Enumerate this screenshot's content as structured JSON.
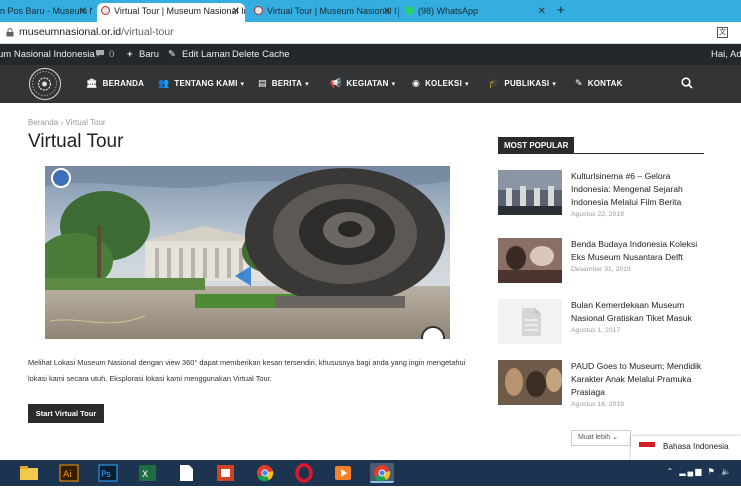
{
  "browser": {
    "tabs": [
      {
        "title": "n Pos Baru - Museum N",
        "active": false
      },
      {
        "title": "Virtual Tour | Museum Nasional In",
        "active": true
      },
      {
        "title": "Virtual Tour | Museum Nasional Ind",
        "active": false
      },
      {
        "title": "(98) WhatsApp",
        "active": false
      }
    ],
    "new_tab_symbol": "+",
    "close_symbol": "✕",
    "url_host": "museumnasional.or.id",
    "url_path": "/virtual-tour",
    "translate_label": "文"
  },
  "admin_bar": {
    "site_name": "um Nasional Indonesia",
    "comments_count": "0",
    "new_label": "Baru",
    "edit_label": "Edit Laman",
    "cache_label": "Delete Cache",
    "greeting": "Hai, Adr"
  },
  "nav": {
    "items": [
      {
        "label": "BERANDA",
        "icon": "bank-icon"
      },
      {
        "label": "TENTANG KAMI",
        "icon": "users-icon",
        "dropdown": true
      },
      {
        "label": "BERITA",
        "icon": "newspaper-icon",
        "dropdown": true
      },
      {
        "label": "KEGIATAN",
        "icon": "megaphone-icon",
        "dropdown": true
      },
      {
        "label": "KOLEKSI",
        "icon": "target-icon",
        "dropdown": true
      },
      {
        "label": "PUBLIKASI",
        "icon": "graduation-cap-icon",
        "dropdown": true
      },
      {
        "label": "KONTAK",
        "icon": "edit-icon"
      }
    ],
    "chevron": "❯"
  },
  "page": {
    "breadcrumb_home": "Beranda",
    "breadcrumb_sep": "›",
    "breadcrumb_current": "Virtual Tour",
    "title": "Virtual Tour",
    "intro": "Melihat Lokasi Museum Nasional dengan view 360° dapat memberikan kesan tersendiri, khususnya bagi anda yang ingin mengetahui lokasi kami secara utuh. Eksplorasi lokasi kami menggunakan Virtual Tour.",
    "start_button": "Start Virtual Tour"
  },
  "sidebar": {
    "heading": "MOST POPULAR",
    "posts": [
      {
        "title": "Kulturlsinema #6 – Gelora Indonesia: Mengenal Sejarah Indonesia Melalui Film Berita",
        "date": "Agustus 22, 2019"
      },
      {
        "title": "Benda Budaya Indonesia Koleksi Eks Museum Nusantara Delft",
        "date": "Desember 31, 2019"
      },
      {
        "title": "Bulan Kemerdekaan Museum Nasional Gratiskan Tiket Masuk",
        "date": "Agustus 1, 2017"
      },
      {
        "title": "PAUD Goes to Museum; Mendidik Karakter Anak Melalui Pramuka Prasiaga",
        "date": "Agustus 16, 2019"
      }
    ],
    "more_button": "Muat lebih",
    "language": "Bahasa Indonesia"
  },
  "colors": {
    "tab_strip": "#34aee0",
    "admin_bar": "#23282d",
    "nav_bar": "#333436",
    "taskbar": "#1c3450"
  }
}
